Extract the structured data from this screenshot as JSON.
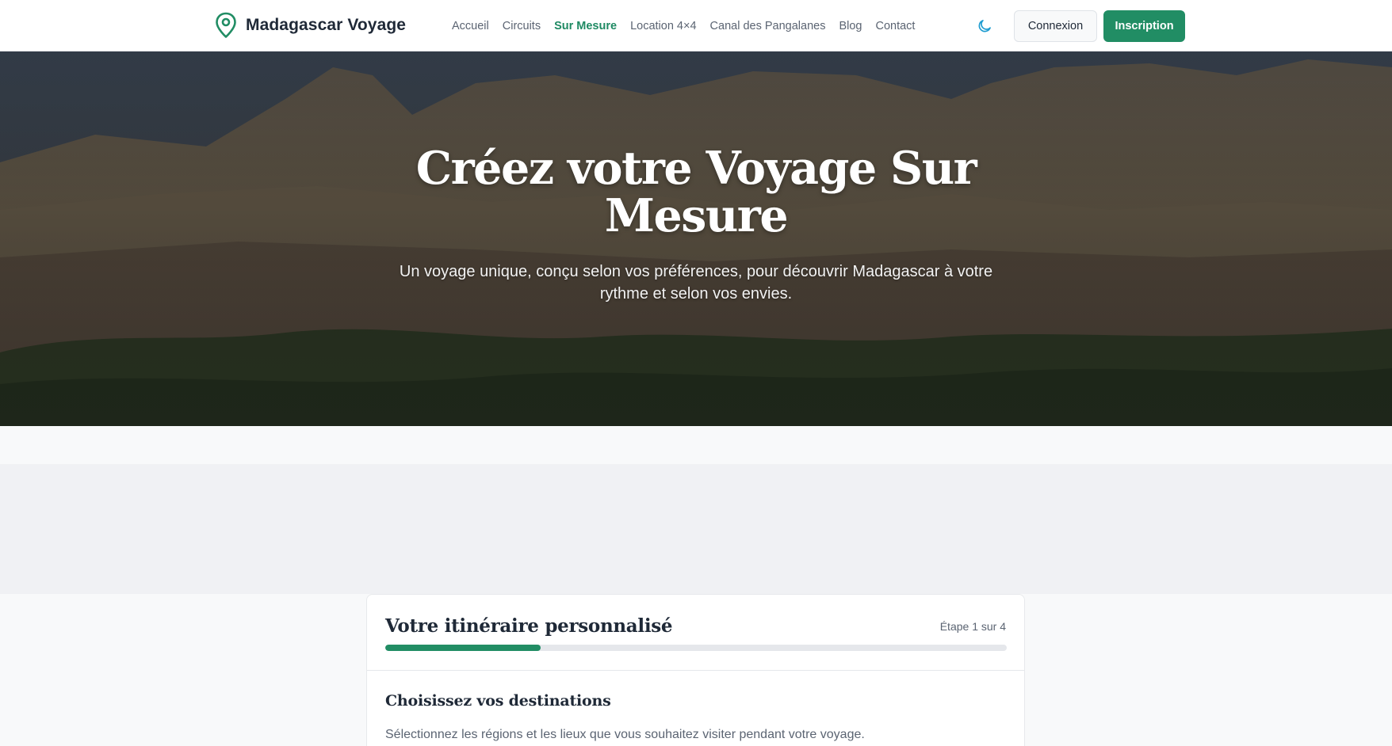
{
  "brand": {
    "name": "Madagascar Voyage",
    "accent": "#218d64",
    "icon": "map-pin-icon"
  },
  "nav": {
    "items": [
      {
        "label": "Accueil",
        "active": false
      },
      {
        "label": "Circuits",
        "active": false
      },
      {
        "label": "Sur Mesure",
        "active": true
      },
      {
        "label": "Location 4×4",
        "active": false
      },
      {
        "label": "Canal des Pangalanes",
        "active": false
      },
      {
        "label": "Blog",
        "active": false
      },
      {
        "label": "Contact",
        "active": false
      }
    ]
  },
  "header_actions": {
    "theme_icon": "moon-icon",
    "login_label": "Connexion",
    "signup_label": "Inscription"
  },
  "hero": {
    "title": "Créez votre Voyage Sur Mesure",
    "subtitle": "Un voyage unique, conçu selon vos préférences, pour découvrir Madagascar à votre rythme et selon vos envies."
  },
  "wizard": {
    "title": "Votre itinéraire personnalisé",
    "step_label": "Étape 1 sur 4",
    "progress": 0.25,
    "section_title": "Choisissez vos destinations",
    "section_desc": "Sélectionnez les régions et les lieux que vous souhaitez visiter pendant votre voyage."
  }
}
